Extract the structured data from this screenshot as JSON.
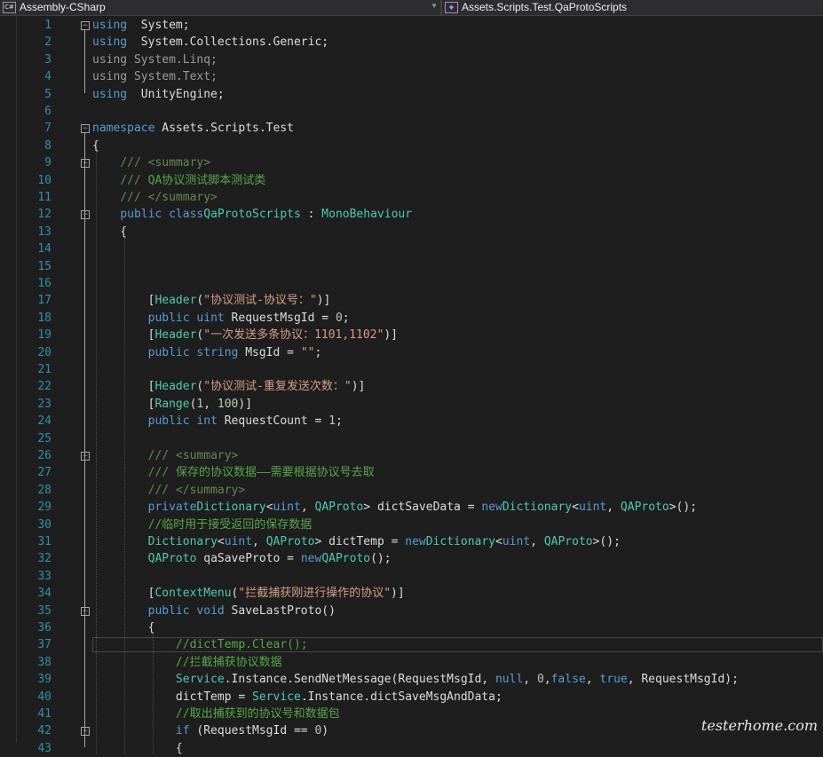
{
  "topbar": {
    "project_icon": "C#",
    "project": "Assembly-CSharp",
    "class_path": "Assets.Scripts.Test.QaProtoScripts"
  },
  "watermark": "testerhome.com",
  "lines": [
    {
      "n": "1",
      "fold": "minus",
      "t": [
        [
          "kw",
          "using"
        ],
        [
          "",
          "  System;"
        ]
      ]
    },
    {
      "n": "2",
      "t": [
        [
          "kw",
          "using"
        ],
        [
          "",
          "  System.Collections.Generic;"
        ]
      ]
    },
    {
      "n": "3",
      "t": [
        [
          "gr",
          "using System.Linq;"
        ]
      ]
    },
    {
      "n": "4",
      "t": [
        [
          "gr",
          "using System.Text;"
        ]
      ]
    },
    {
      "n": "5",
      "t": [
        [
          "kw",
          "using"
        ],
        [
          "",
          "  UnityEngine;"
        ]
      ]
    },
    {
      "n": "6",
      "t": []
    },
    {
      "n": "7",
      "fold": "minus",
      "t": [
        [
          "kw",
          "namespace"
        ],
        [
          "",
          " Assets.Scripts.Test"
        ]
      ]
    },
    {
      "n": "8",
      "t": [
        [
          "",
          "{"
        ]
      ]
    },
    {
      "n": "9",
      "fold": "minus",
      "t": [
        [
          "",
          "    "
        ],
        [
          "xd",
          "/// <summary>"
        ]
      ]
    },
    {
      "n": "10",
      "t": [
        [
          "",
          "    "
        ],
        [
          "xd",
          "/// "
        ],
        [
          "cm",
          "QA协议测试脚本测试类"
        ]
      ]
    },
    {
      "n": "11",
      "t": [
        [
          "",
          "    "
        ],
        [
          "xd",
          "/// </summary>"
        ]
      ]
    },
    {
      "n": "12",
      "fold": "minus",
      "t": [
        [
          "",
          "    "
        ],
        [
          "kw",
          "public class"
        ],
        [
          " ",
          ""
        ],
        [
          "ty",
          "QaProtoScripts"
        ],
        [
          "",
          " : "
        ],
        [
          "ty",
          "MonoBehaviour"
        ]
      ]
    },
    {
      "n": "13",
      "t": [
        [
          "",
          "    {"
        ]
      ]
    },
    {
      "n": "14",
      "t": []
    },
    {
      "n": "15",
      "t": []
    },
    {
      "n": "16",
      "t": []
    },
    {
      "n": "17",
      "t": [
        [
          "",
          "        ["
        ],
        [
          "ty",
          "Header"
        ],
        [
          "",
          "("
        ],
        [
          "st",
          "\"协议测试-协议号：\""
        ],
        [
          "",
          ")]"
        ]
      ]
    },
    {
      "n": "18",
      "t": [
        [
          "",
          "        "
        ],
        [
          "kw",
          "public uint"
        ],
        [
          "",
          " RequestMsgId = "
        ],
        [
          "nu",
          "0"
        ],
        [
          "",
          ";"
        ]
      ]
    },
    {
      "n": "19",
      "t": [
        [
          "",
          "        ["
        ],
        [
          "ty",
          "Header"
        ],
        [
          "",
          "("
        ],
        [
          "st",
          "\"一次发送多条协议：1101,1102\""
        ],
        [
          "",
          ")]"
        ]
      ]
    },
    {
      "n": "20",
      "t": [
        [
          "",
          "        "
        ],
        [
          "kw",
          "public string"
        ],
        [
          "",
          " MsgId = "
        ],
        [
          "st",
          "\"\""
        ],
        [
          "",
          ";"
        ]
      ]
    },
    {
      "n": "21",
      "t": []
    },
    {
      "n": "22",
      "t": [
        [
          "",
          "        ["
        ],
        [
          "ty",
          "Header"
        ],
        [
          "",
          "("
        ],
        [
          "st",
          "\"协议测试-重复发送次数：\""
        ],
        [
          "",
          ")]"
        ]
      ]
    },
    {
      "n": "23",
      "t": [
        [
          "",
          "        ["
        ],
        [
          "ty",
          "Range"
        ],
        [
          "",
          "("
        ],
        [
          "nu",
          "1"
        ],
        [
          "",
          ", "
        ],
        [
          "nu",
          "100"
        ],
        [
          "",
          ")]"
        ]
      ]
    },
    {
      "n": "24",
      "t": [
        [
          "",
          "        "
        ],
        [
          "kw",
          "public int"
        ],
        [
          "",
          " RequestCount = "
        ],
        [
          "nu",
          "1"
        ],
        [
          "",
          ";"
        ]
      ]
    },
    {
      "n": "25",
      "t": []
    },
    {
      "n": "26",
      "fold": "minus",
      "t": [
        [
          "",
          "        "
        ],
        [
          "xd",
          "/// <summary>"
        ]
      ]
    },
    {
      "n": "27",
      "t": [
        [
          "",
          "        "
        ],
        [
          "xd",
          "/// "
        ],
        [
          "cm",
          "保存的协议数据——需要根据协议号去取"
        ]
      ]
    },
    {
      "n": "28",
      "t": [
        [
          "",
          "        "
        ],
        [
          "xd",
          "/// </summary>"
        ]
      ]
    },
    {
      "n": "29",
      "t": [
        [
          "",
          "        "
        ],
        [
          "kw",
          "private"
        ],
        [
          " ",
          ""
        ],
        [
          "ty",
          "Dictionary"
        ],
        [
          "",
          "<"
        ],
        [
          "kw",
          "uint"
        ],
        [
          "",
          ", "
        ],
        [
          "ty",
          "QAProto"
        ],
        [
          "",
          "> dictSaveData = "
        ],
        [
          "kw",
          "new"
        ],
        [
          " ",
          ""
        ],
        [
          "ty",
          "Dictionary"
        ],
        [
          "",
          "<"
        ],
        [
          "kw",
          "uint"
        ],
        [
          "",
          ", "
        ],
        [
          "ty",
          "QAProto"
        ],
        [
          "",
          ">();"
        ]
      ]
    },
    {
      "n": "30",
      "t": [
        [
          "",
          "        "
        ],
        [
          "cm",
          "//临时用于接受返回的保存数据"
        ]
      ]
    },
    {
      "n": "31",
      "t": [
        [
          "",
          "        "
        ],
        [
          "ty",
          "Dictionary"
        ],
        [
          "",
          "<"
        ],
        [
          "kw",
          "uint"
        ],
        [
          "",
          ", "
        ],
        [
          "ty",
          "QAProto"
        ],
        [
          "",
          "> dictTemp = "
        ],
        [
          "kw",
          "new"
        ],
        [
          " ",
          ""
        ],
        [
          "ty",
          "Dictionary"
        ],
        [
          "",
          "<"
        ],
        [
          "kw",
          "uint"
        ],
        [
          "",
          ", "
        ],
        [
          "ty",
          "QAProto"
        ],
        [
          "",
          ">();"
        ]
      ]
    },
    {
      "n": "32",
      "t": [
        [
          "",
          "        "
        ],
        [
          "ty",
          "QAProto"
        ],
        [
          "",
          " qaSaveProto = "
        ],
        [
          "kw",
          "new"
        ],
        [
          " ",
          ""
        ],
        [
          "ty",
          "QAProto"
        ],
        [
          "",
          "();"
        ]
      ]
    },
    {
      "n": "33",
      "t": []
    },
    {
      "n": "34",
      "t": [
        [
          "",
          "        ["
        ],
        [
          "ty",
          "ContextMenu"
        ],
        [
          "",
          "("
        ],
        [
          "st",
          "\"拦截捕获刚进行操作的协议\""
        ],
        [
          "",
          ")]"
        ]
      ]
    },
    {
      "n": "35",
      "fold": "minus",
      "t": [
        [
          "",
          "        "
        ],
        [
          "kw",
          "public void"
        ],
        [
          "",
          " SaveLastProto()"
        ]
      ]
    },
    {
      "n": "36",
      "t": [
        [
          "",
          "        {"
        ]
      ]
    },
    {
      "n": "37",
      "t": [
        [
          "",
          "            "
        ],
        [
          "cm",
          "//dictTemp.Clear();"
        ]
      ]
    },
    {
      "n": "38",
      "t": [
        [
          "",
          "            "
        ],
        [
          "cm",
          "//拦截捕获协议数据"
        ]
      ]
    },
    {
      "n": "39",
      "t": [
        [
          "",
          "            "
        ],
        [
          "ty",
          "Service"
        ],
        [
          "",
          ".Instance.SendNetMessage(RequestMsgId, "
        ],
        [
          "kw",
          "null"
        ],
        [
          "",
          ", "
        ],
        [
          "nu",
          "0"
        ],
        [
          "",
          ","
        ],
        [
          "kw",
          "false"
        ],
        [
          "",
          ", "
        ],
        [
          "kw",
          "true"
        ],
        [
          "",
          ", RequestMsgId);"
        ]
      ]
    },
    {
      "n": "40",
      "t": [
        [
          "",
          "            dictTemp = "
        ],
        [
          "ty",
          "Service"
        ],
        [
          "",
          ".Instance.dictSaveMsgAndData;"
        ]
      ]
    },
    {
      "n": "41",
      "t": [
        [
          "",
          "            "
        ],
        [
          "cm",
          "//取出捕获到的协议号和数据包"
        ]
      ]
    },
    {
      "n": "42",
      "fold": "minus",
      "t": [
        [
          "",
          "            "
        ],
        [
          "kw",
          "if"
        ],
        [
          "",
          " (RequestMsgId == "
        ],
        [
          "nu",
          "0"
        ],
        [
          "",
          ")"
        ]
      ]
    },
    {
      "n": "43",
      "t": [
        [
          "",
          "            {"
        ]
      ]
    }
  ]
}
